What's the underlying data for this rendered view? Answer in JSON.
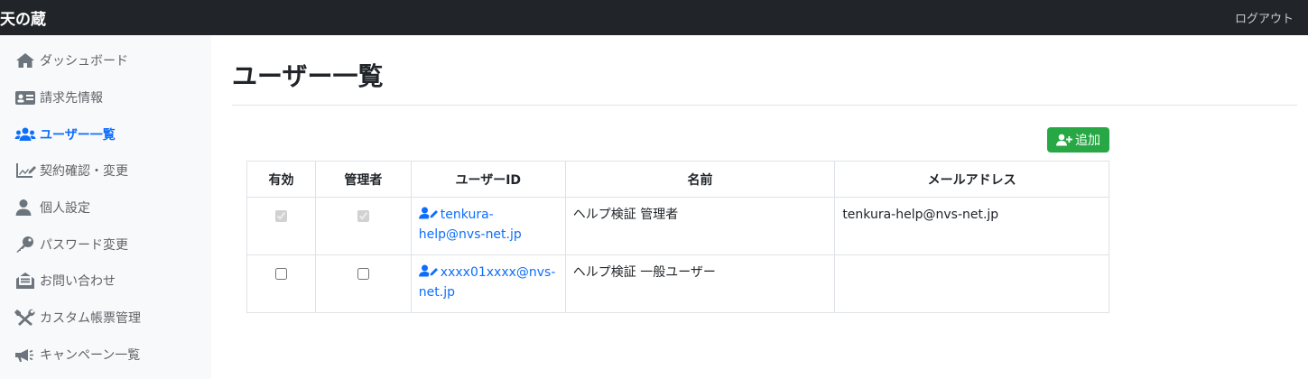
{
  "header": {
    "brand": "天の蔵",
    "logout_label": "ログアウト"
  },
  "sidebar": {
    "items": [
      {
        "label": "ダッシュボード",
        "icon": "home-icon"
      },
      {
        "label": "請求先情報",
        "icon": "id-card-icon"
      },
      {
        "label": "ユーザー一覧",
        "icon": "users-icon",
        "active": true
      },
      {
        "label": "契約確認・変更",
        "icon": "chart-edit-icon"
      },
      {
        "label": "個人設定",
        "icon": "user-icon"
      },
      {
        "label": "パスワード変更",
        "icon": "key-icon"
      },
      {
        "label": "お問い合わせ",
        "icon": "envelope-open-icon"
      },
      {
        "label": "カスタム帳票管理",
        "icon": "tools-icon"
      },
      {
        "label": "キャンペーン一覧",
        "icon": "megaphone-icon"
      }
    ]
  },
  "main": {
    "title": "ユーザー一覧",
    "add_button_label": "追加",
    "table": {
      "headers": [
        "有効",
        "管理者",
        "ユーザーID",
        "名前",
        "メールアドレス"
      ],
      "rows": [
        {
          "enabled": true,
          "admin": true,
          "user_id_line1": "tenkura-",
          "user_id_line2": "help@nvs-net.jp",
          "name": "ヘルプ検証 管理者",
          "email": "tenkura-help@nvs-net.jp"
        },
        {
          "enabled": false,
          "admin": false,
          "user_id_line1": "xxxx01xxxx@nvs-",
          "user_id_line2": "net.jp",
          "name": "ヘルプ検証 一般ユーザー",
          "email": ""
        }
      ]
    }
  },
  "colors": {
    "topbar": "#212529",
    "sidebar_bg": "#f8f9fa",
    "accent": "#0d6efd",
    "add_button": "#28a745"
  }
}
